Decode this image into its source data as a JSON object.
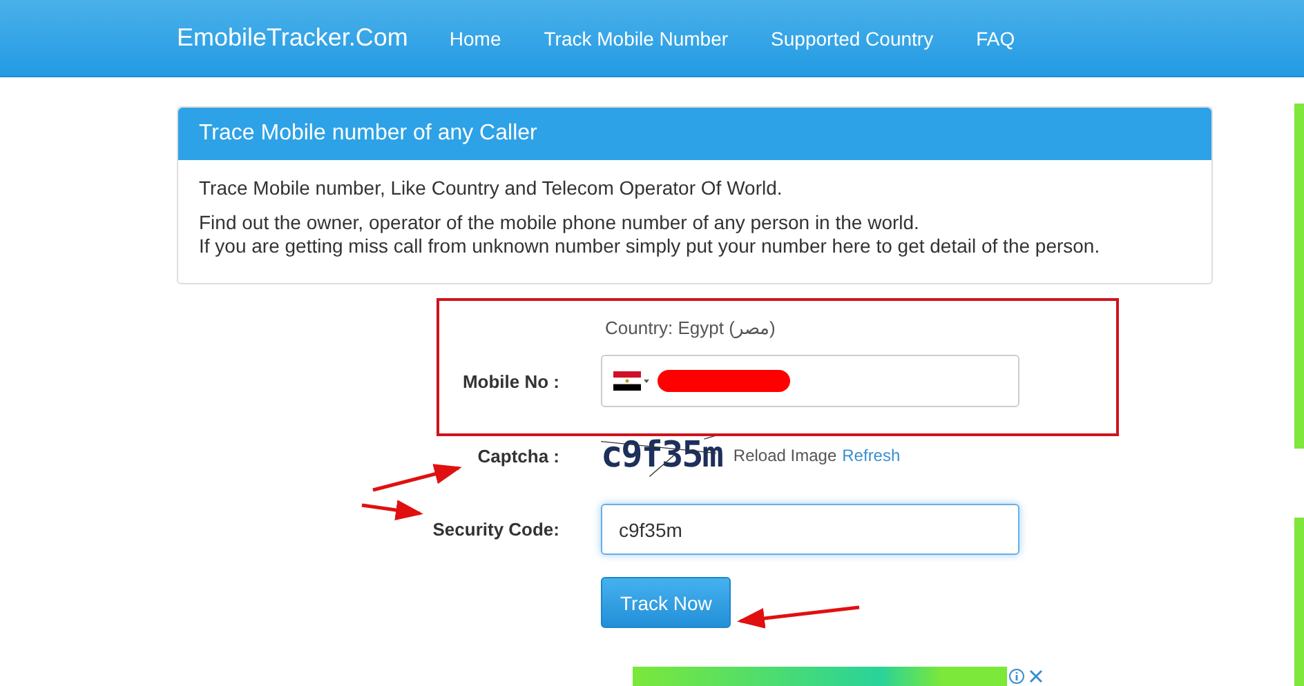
{
  "nav": {
    "brand": "EmobileTracker.Com",
    "links": [
      {
        "label": "Home"
      },
      {
        "label": "Track Mobile Number"
      },
      {
        "label": "Supported Country"
      },
      {
        "label": "FAQ"
      }
    ]
  },
  "panel": {
    "title": "Trace Mobile number of any Caller",
    "intro": "Trace Mobile number, Like Country and Telecom Operator Of World.",
    "lines": [
      "Find out the owner, operator of the mobile phone number of any person in the world.",
      "If you are getting miss call from unknown number simply put your number here to get detail of the person."
    ]
  },
  "form": {
    "country": "Country: Egypt (مصر)",
    "mobile_label": "Mobile No :",
    "captcha_label": "Captcha :",
    "captcha_text": "c9f35m",
    "reload_text": "Reload Image",
    "refresh_link": "Refresh",
    "security_label": "Security Code:",
    "security_value": "c9f35m",
    "submit": "Track Now"
  }
}
